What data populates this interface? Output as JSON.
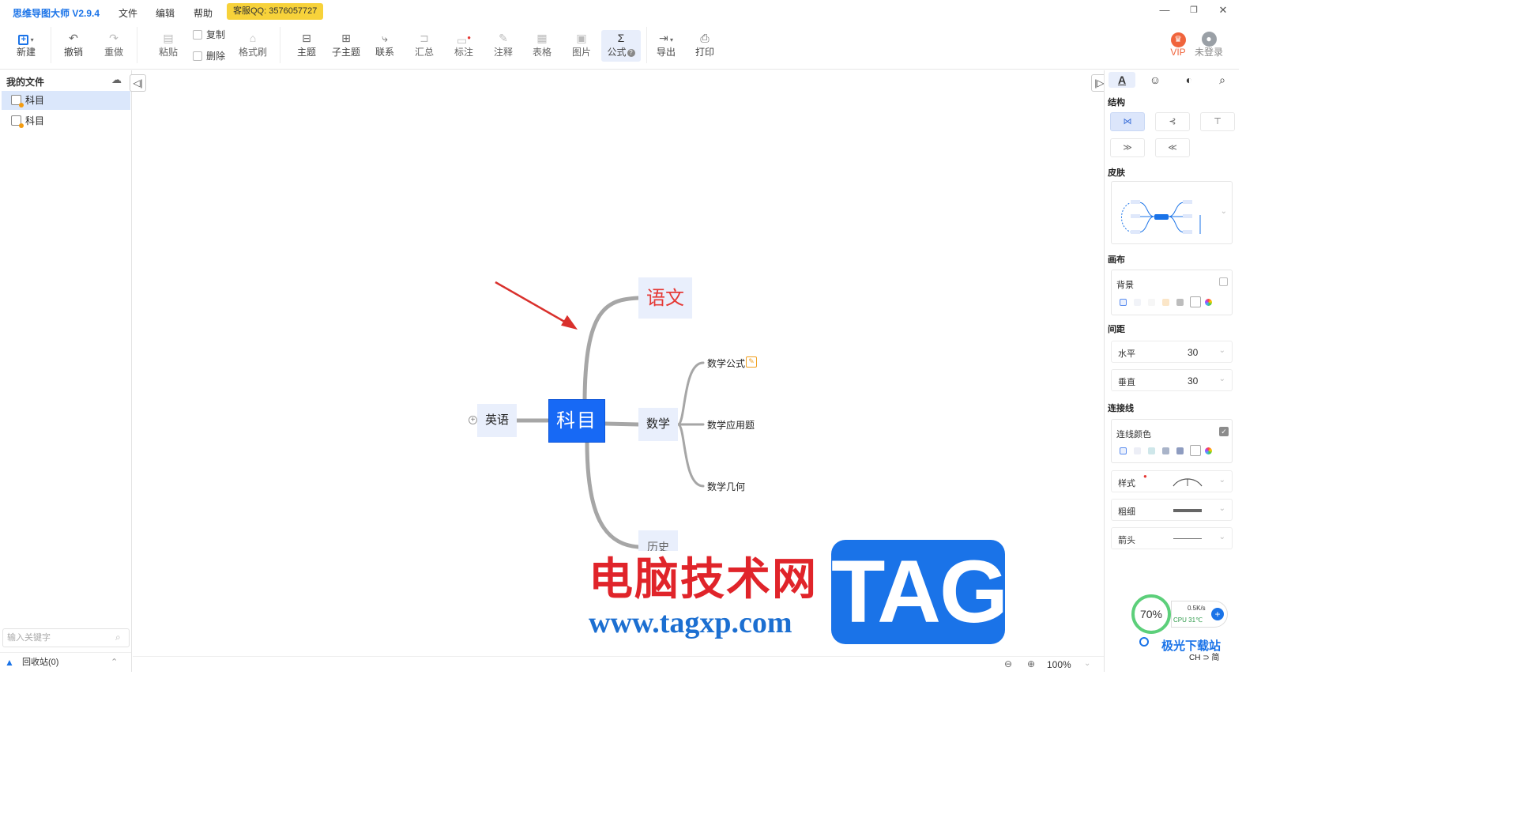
{
  "app": {
    "title": "思维导图大师 V2.9.4"
  },
  "menu": {
    "file": "文件",
    "edit": "编辑",
    "help": "帮助",
    "support": "客服QQ: 3576057727"
  },
  "window": {
    "minimize": "—",
    "restore": "❐",
    "close": "✕"
  },
  "toolbar": {
    "new": "新建",
    "undo": "撤销",
    "redo": "重做",
    "paste": "粘贴",
    "copy": "复制",
    "delete": "删除",
    "format_painter": "格式刷",
    "topic": "主题",
    "subtopic": "子主题",
    "relation": "联系",
    "summary": "汇总",
    "marker": "标注",
    "note": "注释",
    "table": "表格",
    "image": "图片",
    "formula": "公式",
    "export": "导出",
    "print": "打印",
    "vip": "VIP",
    "login": "未登录"
  },
  "sidebar": {
    "title": "我的文件",
    "files": [
      "科目",
      "科目"
    ],
    "search_placeholder": "输入关键字",
    "trash": "回收站(0)"
  },
  "mindmap": {
    "root": "科目",
    "left": "英语",
    "branches": [
      "语文",
      "数学",
      "历史"
    ],
    "math_children": [
      "数学公式",
      "数学应用题",
      "数学几何"
    ]
  },
  "status": {
    "zoom": "100%"
  },
  "panel": {
    "structure": "结构",
    "skin": "皮肤",
    "canvas": "画布",
    "background": "背景",
    "spacing": "间距",
    "horizontal_label": "水平",
    "horizontal_value": "30",
    "vertical_label": "垂直",
    "vertical_value": "30",
    "line": "连接线",
    "line_color": "连线颜色",
    "style": "样式",
    "thickness": "粗细",
    "arrow": "箭头"
  },
  "widget": {
    "percent": "70%",
    "speed": "0.5K/s",
    "cpu": "CPU 31℃",
    "ime": "CH ⊃ 简"
  },
  "watermark": {
    "text": "电脑技术网",
    "url": "www.tagxp.com",
    "tag": "TAG",
    "corner": "极光下载站"
  },
  "colors": {
    "accent": "#1a73e8",
    "root_bg": "#1769f5",
    "branch_bg": "#e9effc",
    "line": "#a6a6a6",
    "arrow": "#d9302c"
  }
}
